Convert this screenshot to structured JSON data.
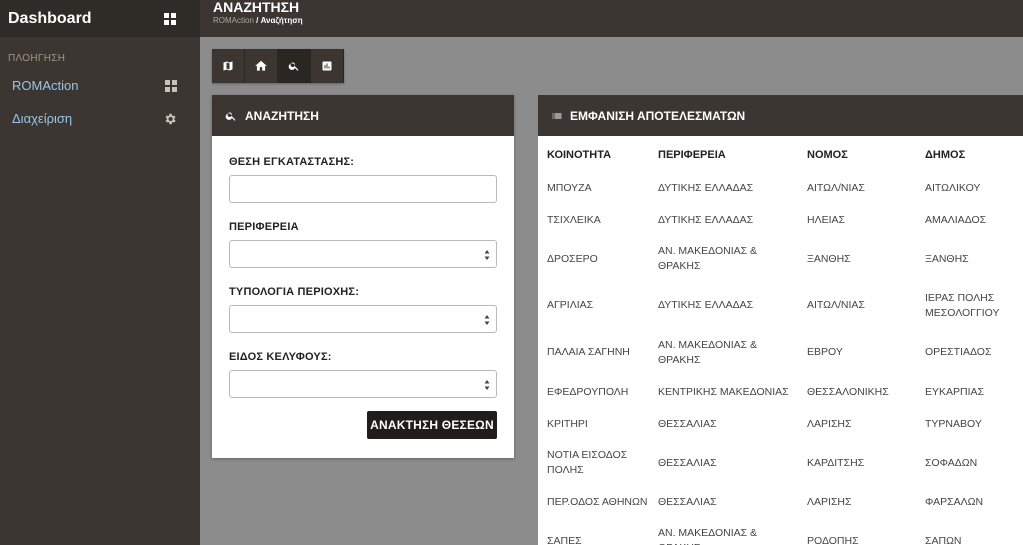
{
  "sidebar": {
    "brand": "Dashboard",
    "section_heading": "ΠΛΟΗΓΗΣΗ",
    "items": [
      {
        "label": "ROMAction",
        "icon": "dashboard-grid-icon"
      },
      {
        "label": "Διαχείριση",
        "icon": "gear-icon"
      }
    ]
  },
  "header": {
    "title": "ΑΝΑΖΗΤΗΣΗ",
    "breadcrumb_link": "ROMAction",
    "breadcrumb_sep": " / ",
    "breadcrumb_current": "Αναζήτηση"
  },
  "toolbar": {
    "buttons": [
      {
        "icon": "map-icon",
        "active": false
      },
      {
        "icon": "home-icon",
        "active": false
      },
      {
        "icon": "search-icon",
        "active": true
      },
      {
        "icon": "bar-chart-icon",
        "active": false
      }
    ]
  },
  "search_panel": {
    "title": "ΑΝΑΖΗΤΗΣΗ",
    "fields": [
      {
        "label": "ΘΕΣΗ ΕΓΚΑΤΑΣΤΑΣΗΣ:",
        "type": "text",
        "value": ""
      },
      {
        "label": "ΠΕΡΙΦΕΡΕΙΑ",
        "type": "select",
        "value": ""
      },
      {
        "label": "ΤΥΠΟΛΟΓΙΑ ΠΕΡΙΟΧΗΣ:",
        "type": "select",
        "value": ""
      },
      {
        "label": "ΕΙΔΟΣ ΚΕΛΥΦΟΥΣ:",
        "type": "select",
        "value": ""
      }
    ],
    "submit_label": "ΑΝΑΚΤΗΣΗ ΘΕΣΕΩΝ"
  },
  "results_panel": {
    "title": "ΕΜΦΑΝΙΣΗ ΑΠΟΤΕΛΕΣΜΑΤΩΝ",
    "columns": [
      "ΚΟΙΝΟΤΗΤΑ",
      "ΠΕΡΙΦΕΡΕΙΑ",
      "ΝΟΜΟΣ",
      "ΔΗΜΟΣ"
    ],
    "rows": [
      [
        "ΜΠΟΥΖΑ",
        "ΔΥΤΙΚΗΣ ΕΛΛΑΔΑΣ",
        "ΑΙΤΩΛ/ΝΙΑΣ",
        "ΑΙΤΩΛΙΚΟΥ"
      ],
      [
        "ΤΣΙΧΛΕΙΚΑ",
        "ΔΥΤΙΚΗΣ ΕΛΛΑΔΑΣ",
        "ΗΛΕΙΑΣ",
        "ΑΜΑΛΙΑΔΟΣ"
      ],
      [
        "ΔΡΟΣΕΡΟ",
        "ΑΝ. ΜΑΚΕΔΟΝΙΑΣ & ΘΡΑΚΗΣ",
        "ΞΑΝΘΗΣ",
        "ΞΑΝΘΗΣ"
      ],
      [
        "ΑΓΡΙΛΙΑΣ",
        "ΔΥΤΙΚΗΣ ΕΛΛΑΔΑΣ",
        "ΑΙΤΩΛ/ΝΙΑΣ",
        "ΙΕΡΑΣ ΠΟΛΗΣ ΜΕΣΟΛΟΓΓΙΟΥ"
      ],
      [
        "ΠΑΛΑΙΑ ΣΑΓΗΝΗ",
        "ΑΝ. ΜΑΚΕΔΟΝΙΑΣ & ΘΡΑΚΗΣ",
        "ΕΒΡΟΥ",
        "ΟΡΕΣΤΙΑΔΟΣ"
      ],
      [
        "ΕΦΕΔΡΟΥΠΟΛΗ",
        "ΚΕΝΤΡΙΚΗΣ ΜΑΚΕΔΟΝΙΑΣ",
        "ΘΕΣΣΑΛΟΝΙΚΗΣ",
        "ΕΥΚΑΡΠΙΑΣ"
      ],
      [
        "ΚΡΙΤΗΡΙ",
        "ΘΕΣΣΑΛΙΑΣ",
        "ΛΑΡΙΣΗΣ",
        "ΤΥΡΝΑΒΟΥ"
      ],
      [
        "ΝΟΤΙΑ ΕΙΣΟΔΟΣ ΠΟΛΗΣ",
        "ΘΕΣΣΑΛΙΑΣ",
        "ΚΑΡΔΙΤΣΗΣ",
        "ΣΟΦΑΔΩΝ"
      ],
      [
        "ΠΕΡ.ΟΔΟΣ ΑΘΗΝΩΝ",
        "ΘΕΣΣΑΛΙΑΣ",
        "ΛΑΡΙΣΗΣ",
        "ΦΑΡΣΑΛΩΝ"
      ],
      [
        "ΣΑΠΕΣ",
        "ΑΝ. ΜΑΚΕΔΟΝΙΑΣ & ΘΡΑΚΗΣ",
        "ΡΟΔΟΠΗΣ",
        "ΣΑΠΩΝ"
      ]
    ]
  }
}
